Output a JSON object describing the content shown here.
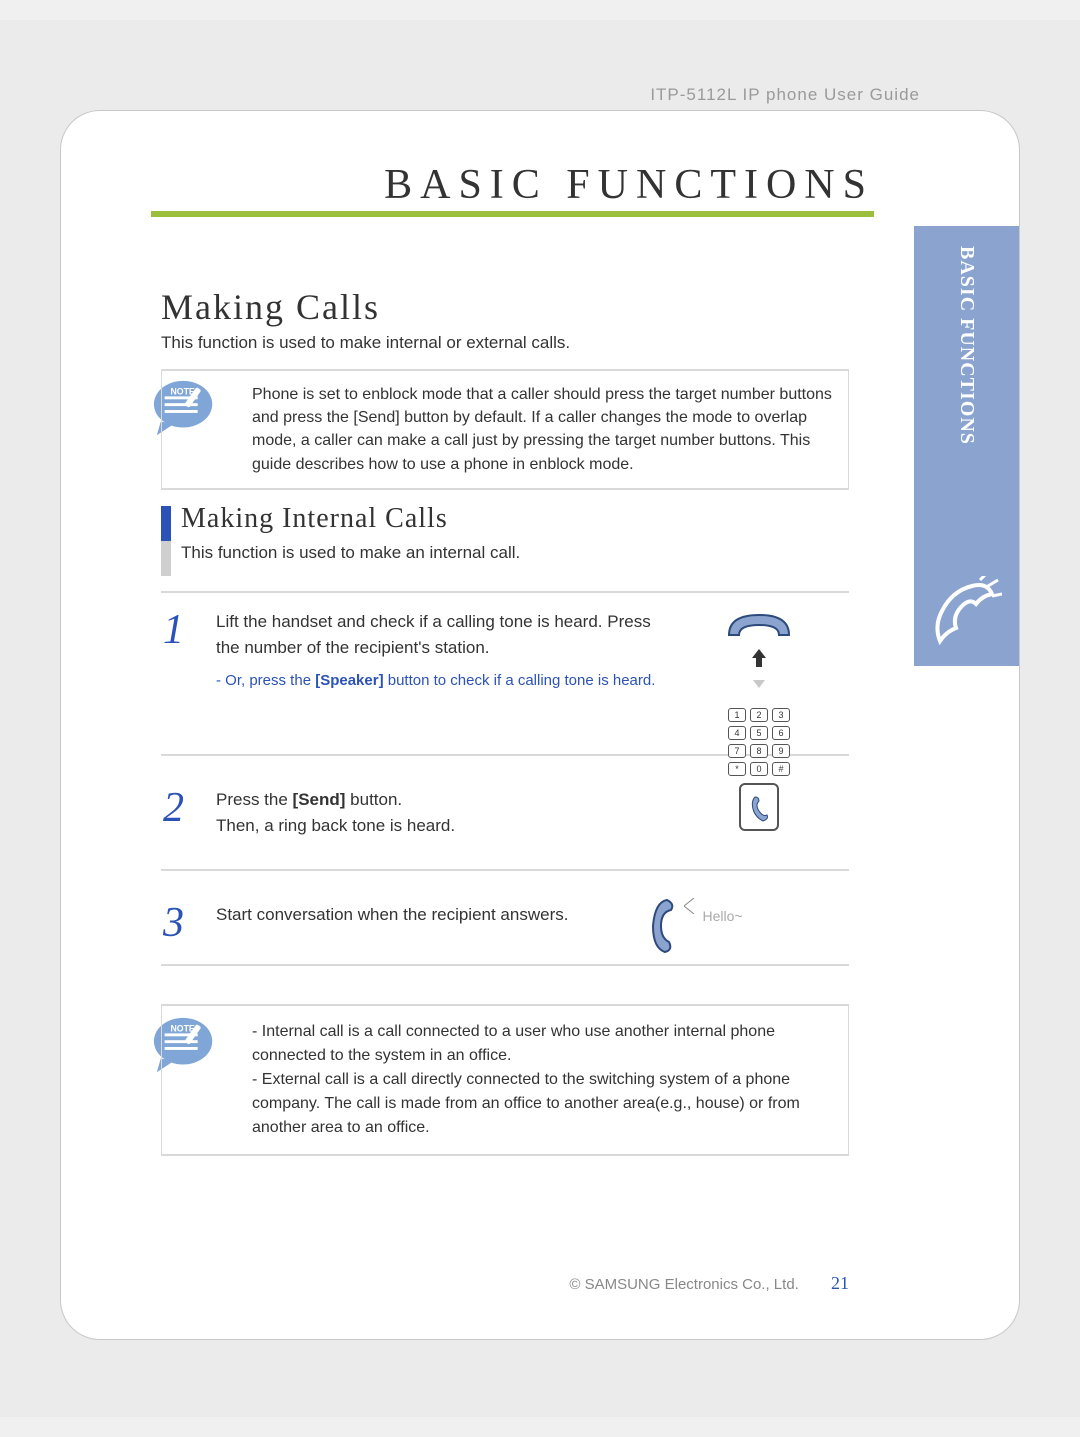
{
  "header": {
    "guide": "ITP-5112L IP phone User Guide"
  },
  "chapter": {
    "title": "BASIC FUNCTIONS"
  },
  "side_tab": {
    "label": "BASIC FUNCTIONS"
  },
  "section": {
    "title": "Making Calls",
    "desc": "This function is used to make internal or external calls."
  },
  "note1": {
    "icon_label": "NOTE",
    "text": "Phone is set to enblock mode that a caller should press the target number buttons and press the [Send] button by default. If a caller changes the mode to overlap mode, a caller can make a call just by pressing the target number buttons. This guide describes how to use a phone in enblock mode."
  },
  "subsection": {
    "title": "Making Internal Calls",
    "desc": "This function is used to make an internal call."
  },
  "steps": [
    {
      "num": "1",
      "text": "Lift the handset and check if a calling tone is heard. Press the number of the recipient's station.",
      "tip_prefix": "- Or, press the ",
      "tip_bold": "[Speaker]",
      "tip_suffix": " button to check if a calling tone is heard.",
      "keys": [
        "1",
        "2",
        "3",
        "4",
        "5",
        "6",
        "7",
        "8",
        "9",
        "*",
        "0",
        "#"
      ]
    },
    {
      "num": "2",
      "text_prefix": "Press the ",
      "text_bold": "[Send]",
      "text_suffix": " button.",
      "text_line2": "Then, a ring back tone is heard."
    },
    {
      "num": "3",
      "text": "Start conversation when the recipient answers.",
      "hello": "Hello~"
    }
  ],
  "note2": {
    "icon_label": "NOTE",
    "bullets": [
      "- Internal call is a call connected to a user who use another internal phone connected to the system in an office.",
      "- External call is a call directly connected to the switching system of a phone company. The call is made from an office to another area(e.g., house) or from another area to an office."
    ]
  },
  "footer": {
    "copyright": "© SAMSUNG Electronics Co., Ltd.",
    "page": "21"
  }
}
